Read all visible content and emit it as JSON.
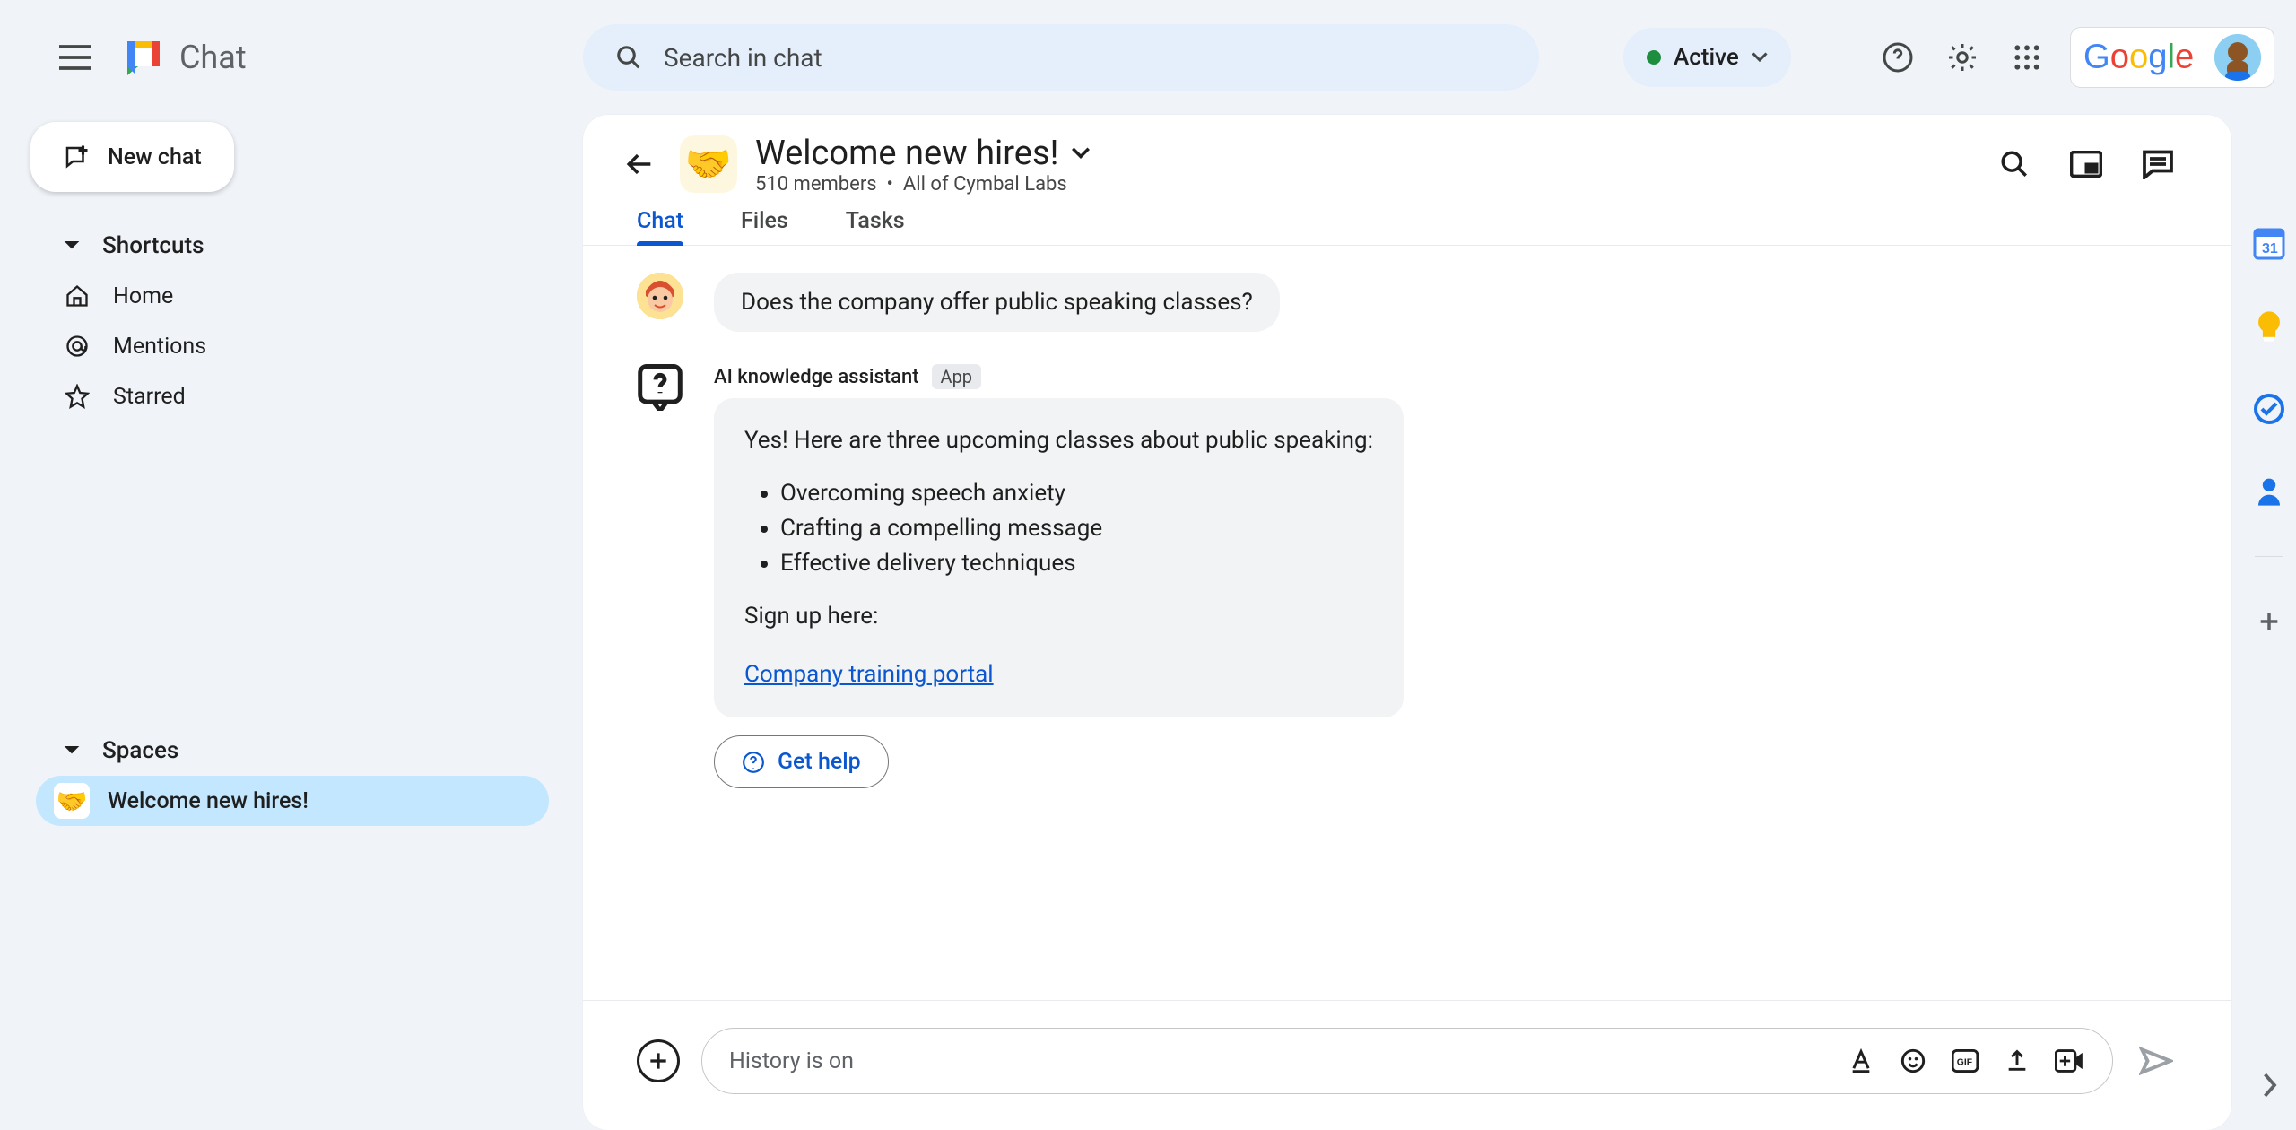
{
  "app_name": "Chat",
  "search_placeholder": "Search in chat",
  "status": {
    "label": "Active"
  },
  "brand": "Google",
  "new_chat_label": "New chat",
  "sidebar": {
    "shortcuts_header": "Shortcuts",
    "items": [
      {
        "label": "Home",
        "icon": "home"
      },
      {
        "label": "Mentions",
        "icon": "at"
      },
      {
        "label": "Starred",
        "icon": "star"
      }
    ],
    "spaces_header": "Spaces",
    "spaces": [
      {
        "label": "Welcome new hires!",
        "emoji": "🤝"
      }
    ]
  },
  "room": {
    "emoji": "🤝",
    "title": "Welcome new hires!",
    "members": "510 members",
    "scope": "All of Cymbal Labs",
    "tabs": [
      "Chat",
      "Files",
      "Tasks"
    ],
    "active_tab": "Chat"
  },
  "messages": [
    {
      "type": "user",
      "text": "Does the company offer public speaking classes?"
    },
    {
      "type": "bot",
      "name": "AI knowledge assistant",
      "chip": "App",
      "intro": "Yes! Here are three upcoming classes about public speaking:",
      "bullets": [
        "Overcoming speech anxiety",
        "Crafting a compelling message",
        "Effective delivery techniques"
      ],
      "signup_text": "Sign up here:",
      "link_text": "Company training portal",
      "action_button": "Get help"
    }
  ],
  "composer": {
    "placeholder": "History is on"
  }
}
